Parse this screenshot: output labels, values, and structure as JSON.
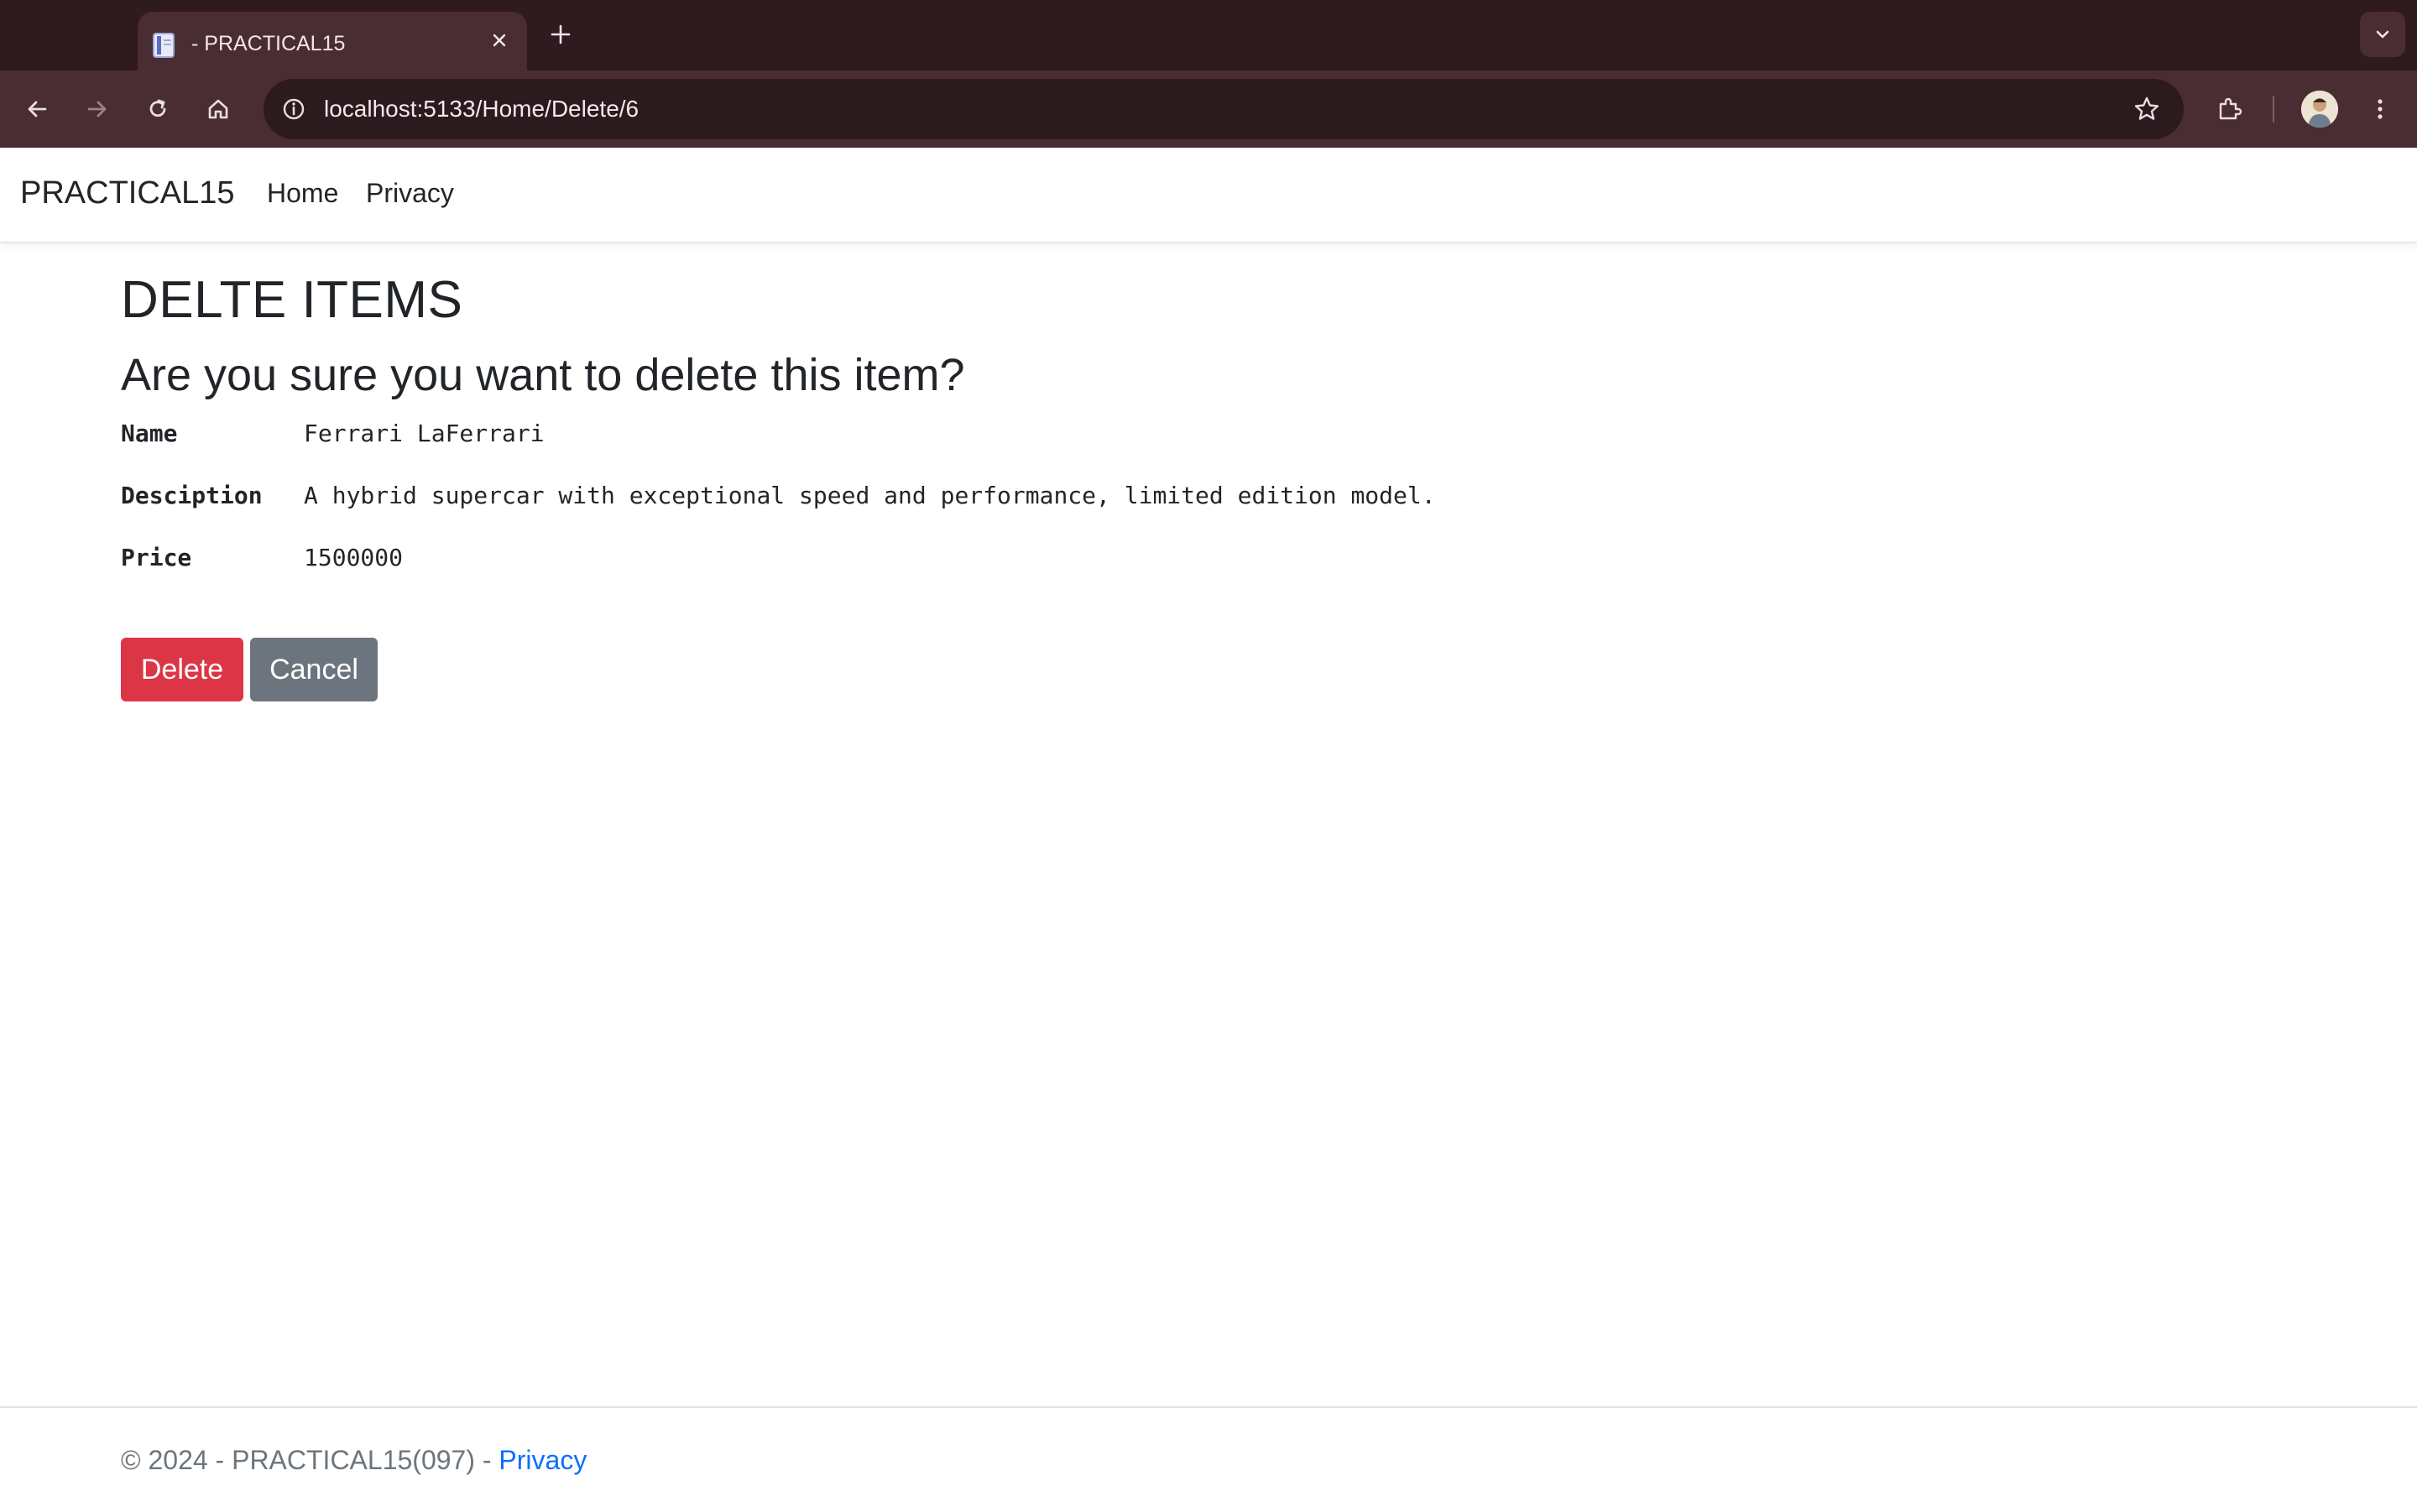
{
  "browser": {
    "tab_title": "- PRACTICAL15",
    "url": "localhost:5133/Home/Delete/6"
  },
  "site": {
    "brand": "PRACTICAL15",
    "nav": [
      {
        "label": "Home"
      },
      {
        "label": "Privacy"
      }
    ]
  },
  "page": {
    "heading": "DELTE ITEMS",
    "question": "Are you sure you want to delete this item?",
    "fields": [
      {
        "label": "Name",
        "value": "Ferrari LaFerrari"
      },
      {
        "label": "Desciption",
        "value": "A hybrid supercar with exceptional speed and performance, limited edition model."
      },
      {
        "label": "Price",
        "value": "1500000"
      }
    ],
    "delete_label": "Delete",
    "cancel_label": "Cancel"
  },
  "footer": {
    "text": "© 2024 - PRACTICAL15(097) - ",
    "link": "Privacy"
  },
  "colors": {
    "danger": "#dc3545",
    "secondary": "#6c757d",
    "link": "#0d6efd",
    "chrome_dark": "#2e1a1f",
    "chrome_toolbar": "#4a2d33"
  }
}
